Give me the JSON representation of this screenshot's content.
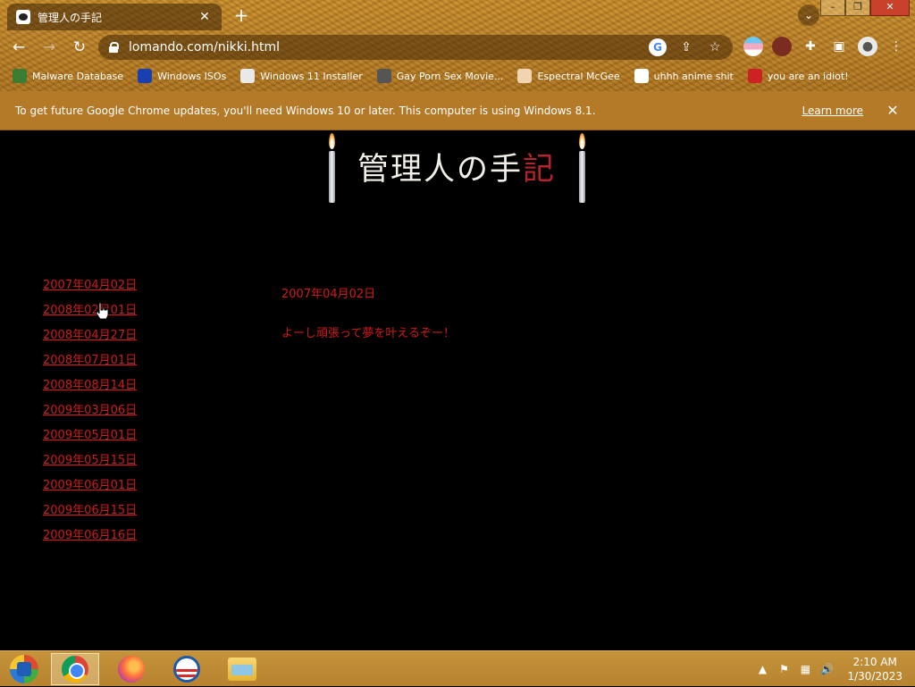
{
  "browser": {
    "tab_title": "管理人の手記",
    "tab_close": "✕",
    "new_tab": "+",
    "dropdown": "⌄",
    "window_buttons": {
      "minimize": "–",
      "restore": "❐",
      "close": "✕"
    },
    "nav": {
      "back": "←",
      "forward": "→",
      "reload": "↻"
    },
    "url": "lomando.com/nikki.html",
    "omnibox_icons": {
      "google": "G",
      "share": "⇪",
      "star": "☆"
    },
    "toolbar_icons": {
      "extensions": "✚",
      "sidepanel": "▣",
      "profile": "●",
      "menu": "⋮"
    },
    "bookmarks": [
      {
        "label": "Malware Database",
        "icon_color": "#3b7d32"
      },
      {
        "label": "Windows ISOs",
        "icon_color": "#1a3fb0"
      },
      {
        "label": "Windows 11 Installer",
        "icon_color": "#ffffff"
      },
      {
        "label": "Gay Porn Sex Movie...",
        "icon_color": "#555555"
      },
      {
        "label": "Espectral McGee",
        "icon_color": "#f0d5b0"
      },
      {
        "label": "uhhh anime shit",
        "icon_color": "#ffffff"
      },
      {
        "label": "you are an idiot!",
        "icon_color": "#cc2222"
      }
    ]
  },
  "infobar": {
    "message": "To get future Google Chrome updates, you'll need Windows 10 or later. This computer is using Windows 8.1.",
    "learn_more": "Learn more",
    "close": "✕"
  },
  "page": {
    "title_part1": "管理人の手",
    "title_part2": "記",
    "dates": [
      "2007年04月02日",
      "2008年02月01日",
      "2008年04月27日",
      "2008年07月01日",
      "2008年08月14日",
      "2009年03月06日",
      "2009年05月01日",
      "2009年05月15日",
      "2009年06月01日",
      "2009年06月15日",
      "2009年06月16日"
    ],
    "entry": {
      "date": "2007年04月02日",
      "text": "よーし頑張って夢を叶えるぞー！"
    }
  },
  "taskbar": {
    "tray_up": "▲",
    "flag": "⚑",
    "network": "▦",
    "volume": "🔊",
    "time": "2:10 AM",
    "date": "1/30/2023"
  },
  "colors": {
    "link_red": "#d11a1a",
    "chrome_gold": "#b9812a",
    "infobar": "#b57a28"
  }
}
